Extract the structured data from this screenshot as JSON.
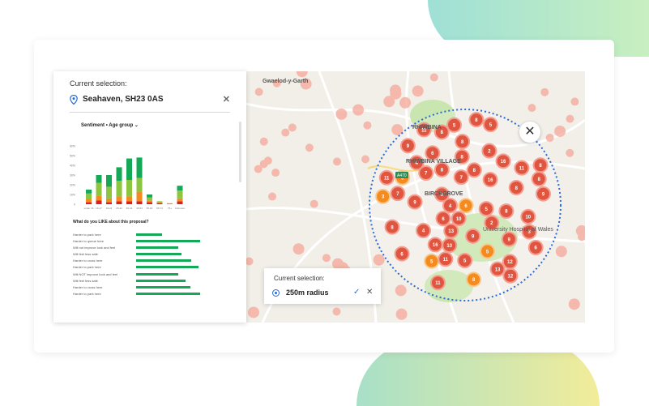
{
  "panel": {
    "current_selection_label": "Current selection:",
    "location": "Seahaven, SH23 0AS",
    "filter_sentiment": "Sentiment",
    "filter_separator": "•",
    "filter_age": "Age group",
    "question": "What do you LIKE about this proposal?",
    "responses": [
      {
        "label": "Harder to park here",
        "value": 0.35
      },
      {
        "label": "Harder to queue here",
        "value": 0.88
      },
      {
        "label": "Will not improve look and feel",
        "value": 0.58
      },
      {
        "label": "Will feel less safe",
        "value": 0.62
      },
      {
        "label": "Harder to cross here",
        "value": 0.75
      },
      {
        "label": "Harder to park here",
        "value": 0.85
      },
      {
        "label": "Will NOT improve look and feel",
        "value": 0.58
      },
      {
        "label": "Will feel less safe",
        "value": 0.68
      },
      {
        "label": "Harder to cross here",
        "value": 0.74
      },
      {
        "label": "Harder to park here",
        "value": 0.88
      }
    ]
  },
  "chart_data": {
    "type": "bar",
    "stacked": true,
    "ylim": [
      0,
      60
    ],
    "yticks": [
      "60%",
      "50%",
      "40%",
      "30%",
      "20%",
      "10%",
      "0"
    ],
    "categories": [
      "under 16",
      "16-17",
      "18-24",
      "25-34",
      "35-44",
      "45-54",
      "55-64",
      "65-74",
      "75+",
      "Unknown"
    ],
    "series": [
      {
        "color": "#e01e1e",
        "values": [
          2,
          4,
          2,
          3,
          3,
          3,
          2,
          1,
          0,
          3
        ]
      },
      {
        "color": "#f58a1e",
        "values": [
          3,
          5,
          4,
          5,
          5,
          10,
          2,
          1,
          1,
          3
        ]
      },
      {
        "color": "#8cc63f",
        "values": [
          6,
          13,
          12,
          16,
          17,
          14,
          3,
          1,
          0,
          8
        ]
      },
      {
        "color": "#13a957",
        "values": [
          4,
          8,
          12,
          14,
          22,
          21,
          3,
          0,
          0,
          5
        ]
      }
    ]
  },
  "map": {
    "place_labels": [
      "Gwaelod-y-Garth",
      "RHIWBINA",
      "RHIWBINA VILLAGE",
      "BIRCHGROVE",
      "University Hospital of Wales",
      "A470"
    ],
    "cluster_counts_red": [
      "8",
      "8",
      "11",
      "6",
      "5",
      "9",
      "5",
      "9",
      "5",
      "11",
      "9",
      "5",
      "10",
      "8",
      "9",
      "8",
      "8",
      "6",
      "9",
      "16",
      "12",
      "7",
      "5",
      "8",
      "7",
      "16",
      "6",
      "9",
      "4",
      "10",
      "6",
      "6",
      "11",
      "11",
      "16",
      "3",
      "12",
      "13",
      "4",
      "2",
      "3",
      "7",
      "8",
      "10",
      "8",
      "5",
      "8",
      "2",
      "8",
      "6",
      "4",
      "11",
      "8",
      "13",
      "8"
    ]
  },
  "selection": {
    "label": "Current selection:",
    "value": "250m radius"
  },
  "colors": {
    "green": "#13a957",
    "light_green": "#8cc63f",
    "orange": "#f58a1e",
    "red": "#e01e1e",
    "cluster_red": "#e0553f",
    "radius_blue": "#2a6bd8"
  }
}
